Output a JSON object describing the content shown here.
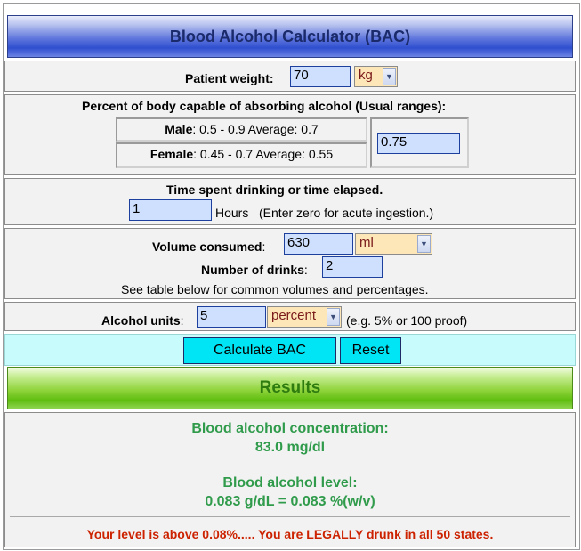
{
  "title": "Blood Alcohol Calculator (BAC)",
  "weight": {
    "label": "Patient weight:",
    "value": "70",
    "unit": "kg"
  },
  "absorb": {
    "heading": "Percent of body capable of absorbing alcohol (Usual ranges):",
    "male_label": "Male",
    "male_text": ": 0.5 - 0.9   Average: 0.7",
    "female_label": "Female",
    "female_text": ": 0.45 - 0.7   Average: 0.55",
    "value": "0.75"
  },
  "time": {
    "heading": "Time spent drinking or time elapsed.",
    "value": "1",
    "unit_text": "Hours   (Enter zero for acute ingestion.)"
  },
  "volume": {
    "label": "Volume consumed",
    "value": "630",
    "unit": "ml",
    "drinks_label": "Number of drinks",
    "drinks_value": "2",
    "note": "See table below for common volumes and percentages."
  },
  "alcohol": {
    "label": "Alcohol units",
    "value": "5",
    "unit": "percent",
    "hint": "(e.g. 5% or 100 proof)"
  },
  "buttons": {
    "calculate": "Calculate BAC",
    "reset": "Reset"
  },
  "results": {
    "heading": "Results",
    "bac_label": "Blood alcohol concentration:",
    "bac_value": "83.0 mg/dl",
    "level_label": "Blood alcohol level:",
    "level_value": "0.083 g/dL = 0.083 %(w/v)",
    "warning": "Your level is above 0.08%..... You are LEGALLY drunk in all 50 states."
  },
  "colors": {
    "title_blue": "#2f4fcf",
    "results_green": "#5fbd10",
    "input_bg": "#cfe0ff",
    "select_bg": "#fde6b8",
    "button_cyan": "#00e5f5",
    "warning_red": "#cc2200",
    "result_text": "#2f9b4b"
  }
}
